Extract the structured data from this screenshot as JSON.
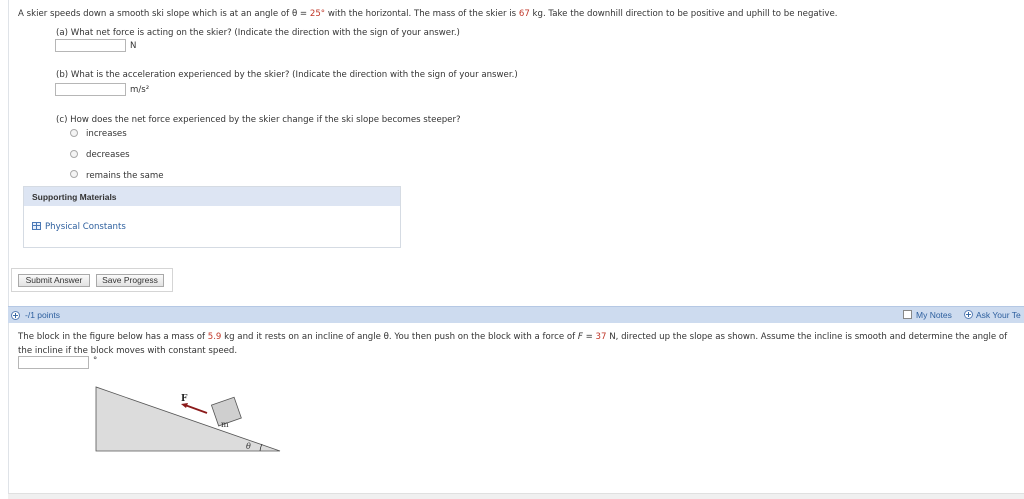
{
  "q1": {
    "text_before": "A skier speeds down a smooth ski slope which is at an angle of θ = ",
    "angle": "25°",
    "text_middle": " with the horizontal. The mass of the skier is ",
    "mass": "67",
    "text_after": " kg. Take the downhill direction to be positive and uphill to be negative.",
    "part_a": {
      "prompt": "(a) What net force is acting on the skier? (Indicate the direction with the sign of your answer.)",
      "value": "",
      "unit": "N"
    },
    "part_b": {
      "prompt": "(b) What is the acceleration experienced by the skier? (Indicate the direction with the sign of your answer.)",
      "value": "",
      "unit": "m/s²"
    },
    "part_c": {
      "prompt": "(c) How does the net force experienced by the skier change if the ski slope becomes steeper?",
      "options": [
        "increases",
        "decreases",
        "remains the same"
      ]
    }
  },
  "supporting": {
    "title": "Supporting Materials",
    "link": "Physical Constants"
  },
  "buttons": {
    "submit": "Submit Answer",
    "save": "Save Progress"
  },
  "q2": {
    "points": "-/1 points",
    "my_notes": "My Notes",
    "ask_teacher": "Ask Your Te",
    "text_before": "The block in the figure below has a mass of ",
    "mass": "5.9",
    "text_mid": " kg and it rests on an incline of angle θ. You then push on the block with a force of ",
    "force_symbol": "F",
    "force_eq": " = ",
    "force": "37",
    "text_after": " N, directed up the slope as shown. Assume the incline is smooth and determine the angle of the incline if the block moves with constant speed.",
    "value": "",
    "unit": "°",
    "figure": {
      "force_label": "F",
      "mass_label": "m",
      "angle_label": "θ"
    }
  },
  "colors": {
    "accent": "#2d5f9e",
    "highlight": "#c0392b",
    "bar": "#cddbef"
  }
}
